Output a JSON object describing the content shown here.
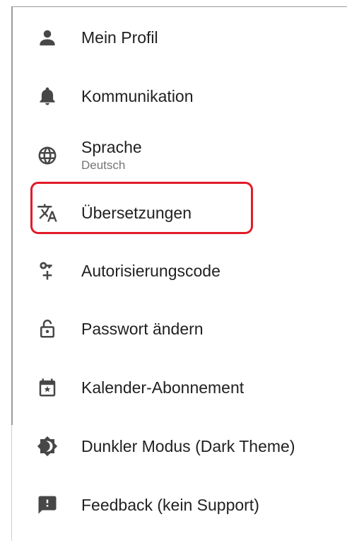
{
  "menu": {
    "items": [
      {
        "id": "profile",
        "label": "Mein Profil",
        "icon": "person-icon"
      },
      {
        "id": "communication",
        "label": "Kommunikation",
        "icon": "bell-icon"
      },
      {
        "id": "language",
        "label": "Sprache",
        "sublabel": "Deutsch",
        "icon": "globe-icon"
      },
      {
        "id": "translations",
        "label": "Übersetzungen",
        "icon": "translate-icon",
        "highlighted": true
      },
      {
        "id": "auth-code",
        "label": "Autorisierungscode",
        "icon": "key-plus-icon"
      },
      {
        "id": "password",
        "label": "Passwort ändern",
        "icon": "lock-open-icon"
      },
      {
        "id": "calendar",
        "label": "Kalender-Abonnement",
        "icon": "calendar-icon"
      },
      {
        "id": "dark-mode",
        "label": "Dunkler Modus (Dark Theme)",
        "icon": "brightness-icon"
      },
      {
        "id": "feedback",
        "label": "Feedback (kein Support)",
        "icon": "feedback-icon"
      }
    ]
  },
  "colors": {
    "highlight": "#e11b2a",
    "icon": "#474747",
    "text": "#212121",
    "subtext": "#757575"
  }
}
